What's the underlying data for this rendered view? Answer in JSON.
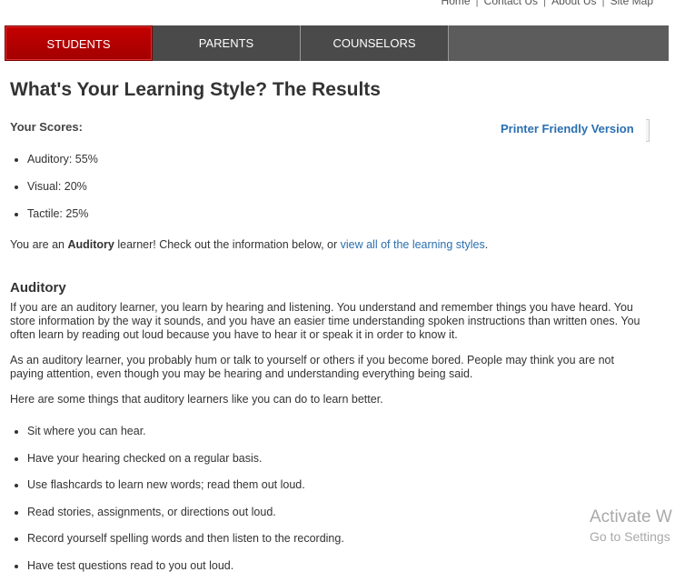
{
  "top_links": [
    "Home",
    "Contact Us",
    "About Us",
    "Site Map"
  ],
  "nav": {
    "tabs": [
      "STUDENTS",
      "PARENTS",
      "COUNSELORS"
    ],
    "active": "STUDENTS"
  },
  "page_title": "What's Your Learning Style? The Results",
  "scores": {
    "label": "Your Scores:",
    "items": [
      "Auditory: 55%",
      "Visual: 20%",
      "Tactile: 25%"
    ]
  },
  "printer_link": "Printer Friendly Version",
  "result_line": {
    "prefix": "You are an ",
    "style": "Auditory",
    "middle": " learner! Check out the information below, or ",
    "link": "view all of the learning styles",
    "suffix": "."
  },
  "section": {
    "heading": "Auditory",
    "paragraphs": [
      "If you are an auditory learner, you learn by hearing and listening. You understand and remember things you have heard. You store information by the way it sounds, and you have an easier time understanding spoken instructions than written ones. You often learn by reading out loud because you have to hear it or speak it in order to know it.",
      "As an auditory learner, you probably hum or talk to yourself or others if you become bored. People may think you are not paying attention, even though you may be hearing and understanding everything being said.",
      "Here are some things that auditory learners like you can do to learn better."
    ],
    "tips": [
      "Sit where you can hear.",
      "Have your hearing checked on a regular basis.",
      "Use flashcards to learn new words; read them out loud.",
      "Read stories, assignments, or directions out loud.",
      "Record yourself spelling words and then listen to the recording.",
      "Have test questions read to you out loud."
    ]
  },
  "watermark": {
    "line1": "Activate W",
    "line2": "Go to Settings"
  },
  "colors": {
    "active_tab": "#b30000",
    "nav_bg": "#4a4a4a",
    "link": "#2a6fb0"
  }
}
